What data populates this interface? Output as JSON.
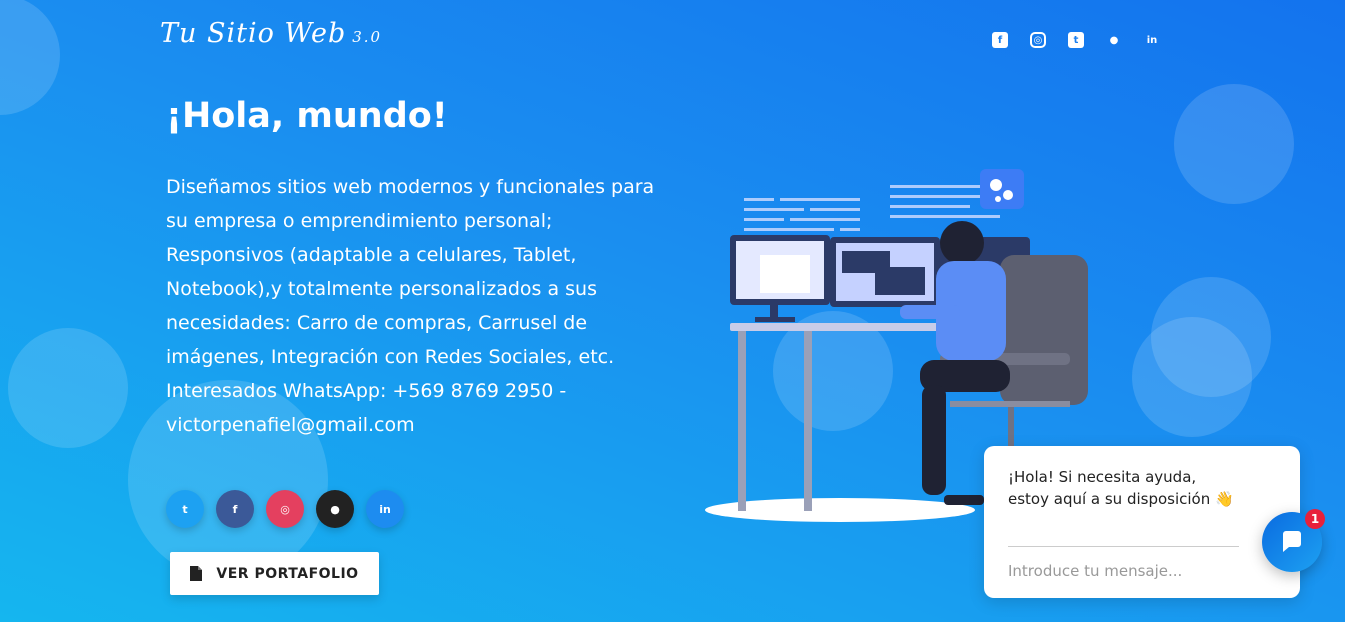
{
  "brand": {
    "logo": "Tu Sitio Web",
    "version": "3.0"
  },
  "header": {
    "social": [
      {
        "name": "facebook-icon",
        "glyph": "f"
      },
      {
        "name": "instagram-icon",
        "glyph": "◎"
      },
      {
        "name": "twitter-icon",
        "glyph": "t"
      },
      {
        "name": "github-icon",
        "glyph": "●"
      },
      {
        "name": "linkedin-icon",
        "glyph": "in"
      }
    ]
  },
  "hero": {
    "title": "¡Hola, mundo!",
    "description": "Diseñamos sitios web modernos y funcionales para su empresa o emprendimiento personal; Responsivos (adaptable a celulares, Tablet, Notebook),y totalmente personalizados a sus necesidades: Carro de compras, Carrusel de imágenes, Integración con Redes Sociales, etc. Interesados WhatsApp: +569 8769 2950 - victorpenafiel@gmail.com"
  },
  "social_buttons": [
    {
      "name": "twitter",
      "glyph": "t",
      "color": "#1da1f2"
    },
    {
      "name": "facebook",
      "glyph": "f",
      "color": "#3b5998"
    },
    {
      "name": "instagram",
      "glyph": "◎",
      "color": "#e4405f"
    },
    {
      "name": "github",
      "glyph": "●",
      "color": "#222222"
    },
    {
      "name": "linkedin",
      "glyph": "in",
      "color": "#1d8cf0"
    }
  ],
  "cta": {
    "label": "VER PORTAFOLIO",
    "icon": "file-icon"
  },
  "chat": {
    "message": "¡Hola! Si necesita ayuda, estoy aquí a su disposición 👋",
    "placeholder": "Introduce tu mensaje...",
    "badge": "1"
  },
  "colors": {
    "gradient_start": "#1373ee",
    "gradient_end": "#15b6ef",
    "chat_button": "#0a6be0",
    "badge": "#e8203a"
  }
}
